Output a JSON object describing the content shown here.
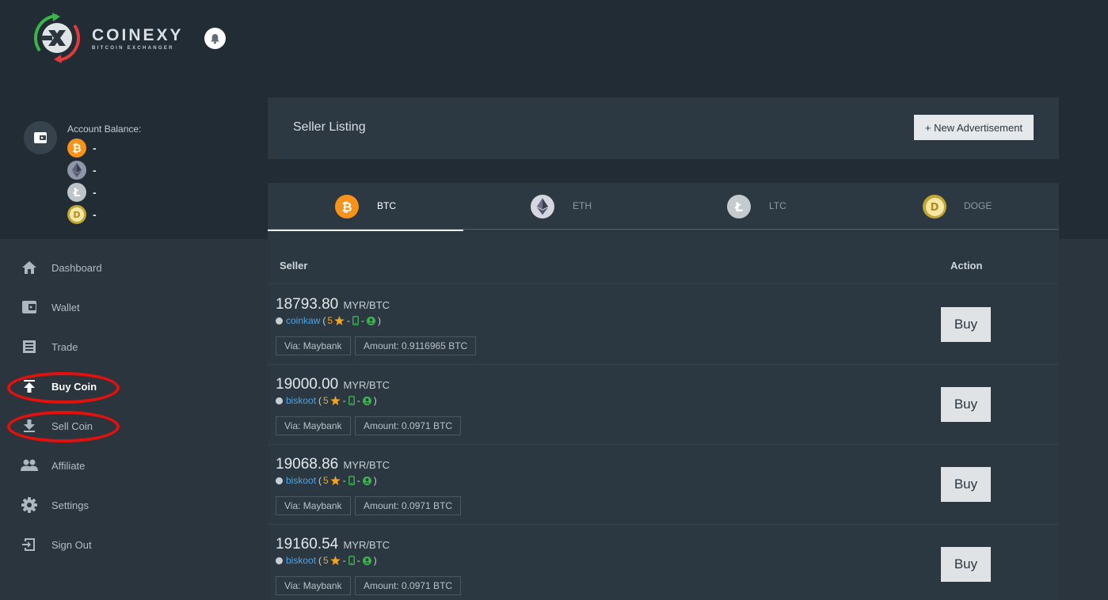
{
  "brand": {
    "name": "COINEXY",
    "tagline": "BITCOIN EXCHANGER"
  },
  "account": {
    "label": "Account Balance:",
    "balances": [
      {
        "coin": "BTC",
        "icon": "bitcoin-icon",
        "value": "-"
      },
      {
        "coin": "ETH",
        "icon": "ethereum-icon",
        "value": "-"
      },
      {
        "coin": "LTC",
        "icon": "litecoin-icon",
        "value": "-"
      },
      {
        "coin": "DOGE",
        "icon": "dogecoin-icon",
        "value": "-"
      }
    ]
  },
  "sidebar": {
    "items": [
      {
        "label": "Dashboard",
        "icon": "home-icon",
        "active": false
      },
      {
        "label": "Wallet",
        "icon": "wallet-icon",
        "active": false
      },
      {
        "label": "Trade",
        "icon": "trade-icon",
        "active": false
      },
      {
        "label": "Buy Coin",
        "icon": "upload-icon",
        "active": true
      },
      {
        "label": "Sell Coin",
        "icon": "download-icon",
        "active": false
      },
      {
        "label": "Affiliate",
        "icon": "people-icon",
        "active": false
      },
      {
        "label": "Settings",
        "icon": "gear-icon",
        "active": false
      },
      {
        "label": "Sign Out",
        "icon": "sign-out-icon",
        "active": false
      }
    ]
  },
  "listing": {
    "title": "Seller Listing",
    "new_ad_label": "+ New Advertisement"
  },
  "tabs": [
    {
      "label": "BTC",
      "active": true
    },
    {
      "label": "ETH",
      "active": false
    },
    {
      "label": "LTC",
      "active": false
    },
    {
      "label": "DOGE",
      "active": false
    }
  ],
  "table": {
    "headers": {
      "seller": "Seller",
      "action": "Action"
    },
    "rows": [
      {
        "price": "18793.80",
        "unit": "MYR/BTC",
        "seller": "coinkaw",
        "rating": "5",
        "via": "Via: Maybank",
        "amount": "Amount: 0.9116965 BTC",
        "buy_label": "Buy"
      },
      {
        "price": "19000.00",
        "unit": "MYR/BTC",
        "seller": "biskoot",
        "rating": "5",
        "via": "Via: Maybank",
        "amount": "Amount: 0.0971 BTC",
        "buy_label": "Buy"
      },
      {
        "price": "19068.86",
        "unit": "MYR/BTC",
        "seller": "biskoot",
        "rating": "5",
        "via": "Via: Maybank",
        "amount": "Amount: 0.0971 BTC",
        "buy_label": "Buy"
      },
      {
        "price": "19160.54",
        "unit": "MYR/BTC",
        "seller": "biskoot",
        "rating": "5",
        "via": "Via: Maybank",
        "amount": "Amount: 0.0971 BTC",
        "buy_label": "Buy"
      }
    ],
    "separator": "-",
    "paren_open": "(",
    "paren_close": ")"
  },
  "colors": {
    "background": "#222d36",
    "panel": "#2d3942",
    "accent_link": "#4da3e6",
    "star": "#f3a51b",
    "verify_green": "#3bb54a",
    "highlight_red": "#e4100c"
  }
}
